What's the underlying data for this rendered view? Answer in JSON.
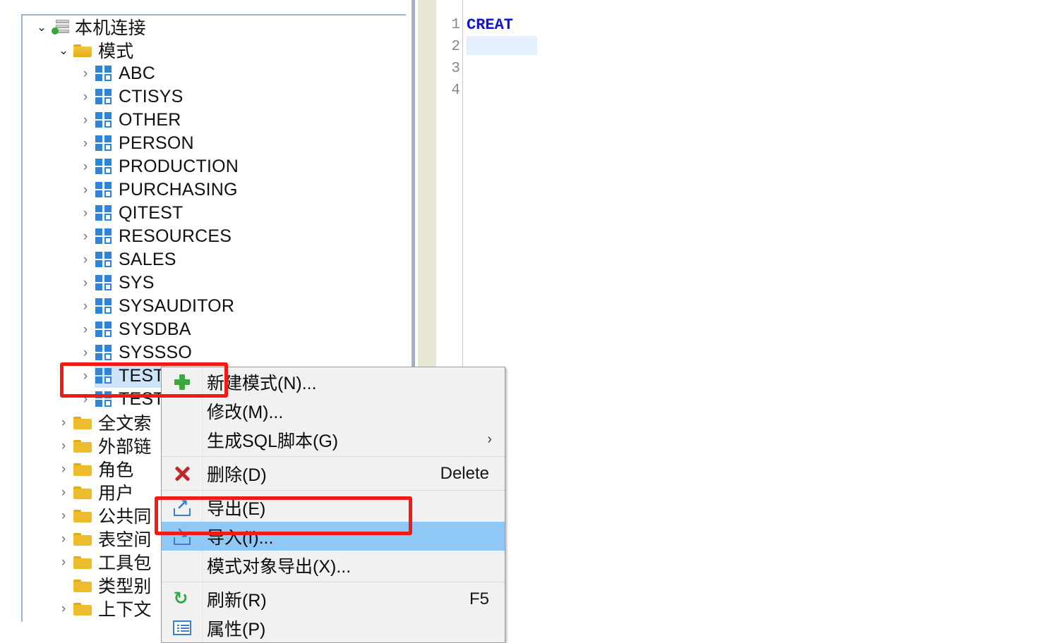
{
  "tree": {
    "panel_name": "database-object-tree",
    "rows": [
      {
        "label": "本机连接",
        "indent": 0,
        "twisty": "expanded",
        "icon": "connection-icon"
      },
      {
        "label": "模式",
        "indent": 1,
        "twisty": "expanded",
        "icon": "folder-open-icon"
      },
      {
        "label": "ABC",
        "indent": 2,
        "twisty": "collapsed",
        "icon": "schema-icon"
      },
      {
        "label": "CTISYS",
        "indent": 2,
        "twisty": "collapsed",
        "icon": "schema-icon"
      },
      {
        "label": "OTHER",
        "indent": 2,
        "twisty": "collapsed",
        "icon": "schema-icon"
      },
      {
        "label": "PERSON",
        "indent": 2,
        "twisty": "collapsed",
        "icon": "schema-icon"
      },
      {
        "label": "PRODUCTION",
        "indent": 2,
        "twisty": "collapsed",
        "icon": "schema-icon"
      },
      {
        "label": "PURCHASING",
        "indent": 2,
        "twisty": "collapsed",
        "icon": "schema-icon"
      },
      {
        "label": "QITEST",
        "indent": 2,
        "twisty": "collapsed",
        "icon": "schema-icon"
      },
      {
        "label": "RESOURCES",
        "indent": 2,
        "twisty": "collapsed",
        "icon": "schema-icon"
      },
      {
        "label": "SALES",
        "indent": 2,
        "twisty": "collapsed",
        "icon": "schema-icon"
      },
      {
        "label": "SYS",
        "indent": 2,
        "twisty": "collapsed",
        "icon": "schema-icon"
      },
      {
        "label": "SYSAUDITOR",
        "indent": 2,
        "twisty": "collapsed",
        "icon": "schema-icon"
      },
      {
        "label": "SYSDBA",
        "indent": 2,
        "twisty": "collapsed",
        "icon": "schema-icon"
      },
      {
        "label": "SYSSSO",
        "indent": 2,
        "twisty": "collapsed",
        "icon": "schema-icon"
      },
      {
        "label": "TEST",
        "indent": 2,
        "twisty": "collapsed",
        "icon": "schema-icon",
        "selected": true
      },
      {
        "label": "TEST",
        "indent": 2,
        "twisty": "collapsed",
        "icon": "schema-icon"
      },
      {
        "label": "全文索",
        "indent": 1,
        "twisty": "collapsed",
        "icon": "folder-icon"
      },
      {
        "label": "外部链",
        "indent": 1,
        "twisty": "collapsed",
        "icon": "folder-icon"
      },
      {
        "label": "角色",
        "indent": 1,
        "twisty": "collapsed",
        "icon": "folder-icon"
      },
      {
        "label": "用户",
        "indent": 1,
        "twisty": "collapsed",
        "icon": "folder-icon"
      },
      {
        "label": "公共同",
        "indent": 1,
        "twisty": "collapsed",
        "icon": "folder-icon"
      },
      {
        "label": "表空间",
        "indent": 1,
        "twisty": "collapsed",
        "icon": "folder-icon"
      },
      {
        "label": "工具包",
        "indent": 1,
        "twisty": "collapsed",
        "icon": "folder-icon"
      },
      {
        "label": "类型别",
        "indent": 1,
        "twisty": "none",
        "icon": "folder-icon"
      },
      {
        "label": "上下文",
        "indent": 1,
        "twisty": "collapsed",
        "icon": "folder-icon"
      }
    ]
  },
  "editor": {
    "line_numbers": [
      "1",
      "2",
      "3",
      "4"
    ],
    "lines": [
      {
        "text": "CREAT",
        "style": "keyword"
      },
      {
        "text": "",
        "style": "caretline"
      },
      {
        "text": "",
        "style": "plain"
      },
      {
        "text": "",
        "style": "plain"
      }
    ]
  },
  "context_menu": {
    "items": [
      {
        "label": "新建模式(N)...",
        "icon": "plus-icon",
        "accel": "",
        "submenu": false,
        "highlighted": false,
        "sep_after": false
      },
      {
        "label": "修改(M)...",
        "icon": "",
        "accel": "",
        "submenu": false,
        "highlighted": false,
        "sep_after": false
      },
      {
        "label": "生成SQL脚本(G)",
        "icon": "",
        "accel": "",
        "submenu": true,
        "highlighted": false,
        "sep_after": true
      },
      {
        "label": "删除(D)",
        "icon": "delete-icon",
        "accel": "Delete",
        "submenu": false,
        "highlighted": false,
        "sep_after": true
      },
      {
        "label": "导出(E)",
        "icon": "export-icon",
        "accel": "",
        "submenu": false,
        "highlighted": false,
        "sep_after": false
      },
      {
        "label": "导入(I)...",
        "icon": "import-icon",
        "accel": "",
        "submenu": false,
        "highlighted": true,
        "sep_after": false
      },
      {
        "label": "模式对象导出(X)...",
        "icon": "",
        "accel": "",
        "submenu": false,
        "highlighted": false,
        "sep_after": true
      },
      {
        "label": "刷新(R)",
        "icon": "refresh-icon",
        "accel": "F5",
        "submenu": false,
        "highlighted": false,
        "sep_after": false
      },
      {
        "label": "属性(P)",
        "icon": "properties-icon",
        "accel": "",
        "submenu": false,
        "highlighted": false,
        "sep_after": false
      }
    ]
  },
  "annotations": {
    "colors": {
      "highlight_box": "#f01b14",
      "menu_highlight": "#8fc8f5",
      "tree_selection": "#cde3f7"
    },
    "boxes": [
      {
        "name": "test-schema-highlight",
        "target": "TEST"
      },
      {
        "name": "import-menu-highlight",
        "target": "导入(I)..."
      }
    ]
  }
}
